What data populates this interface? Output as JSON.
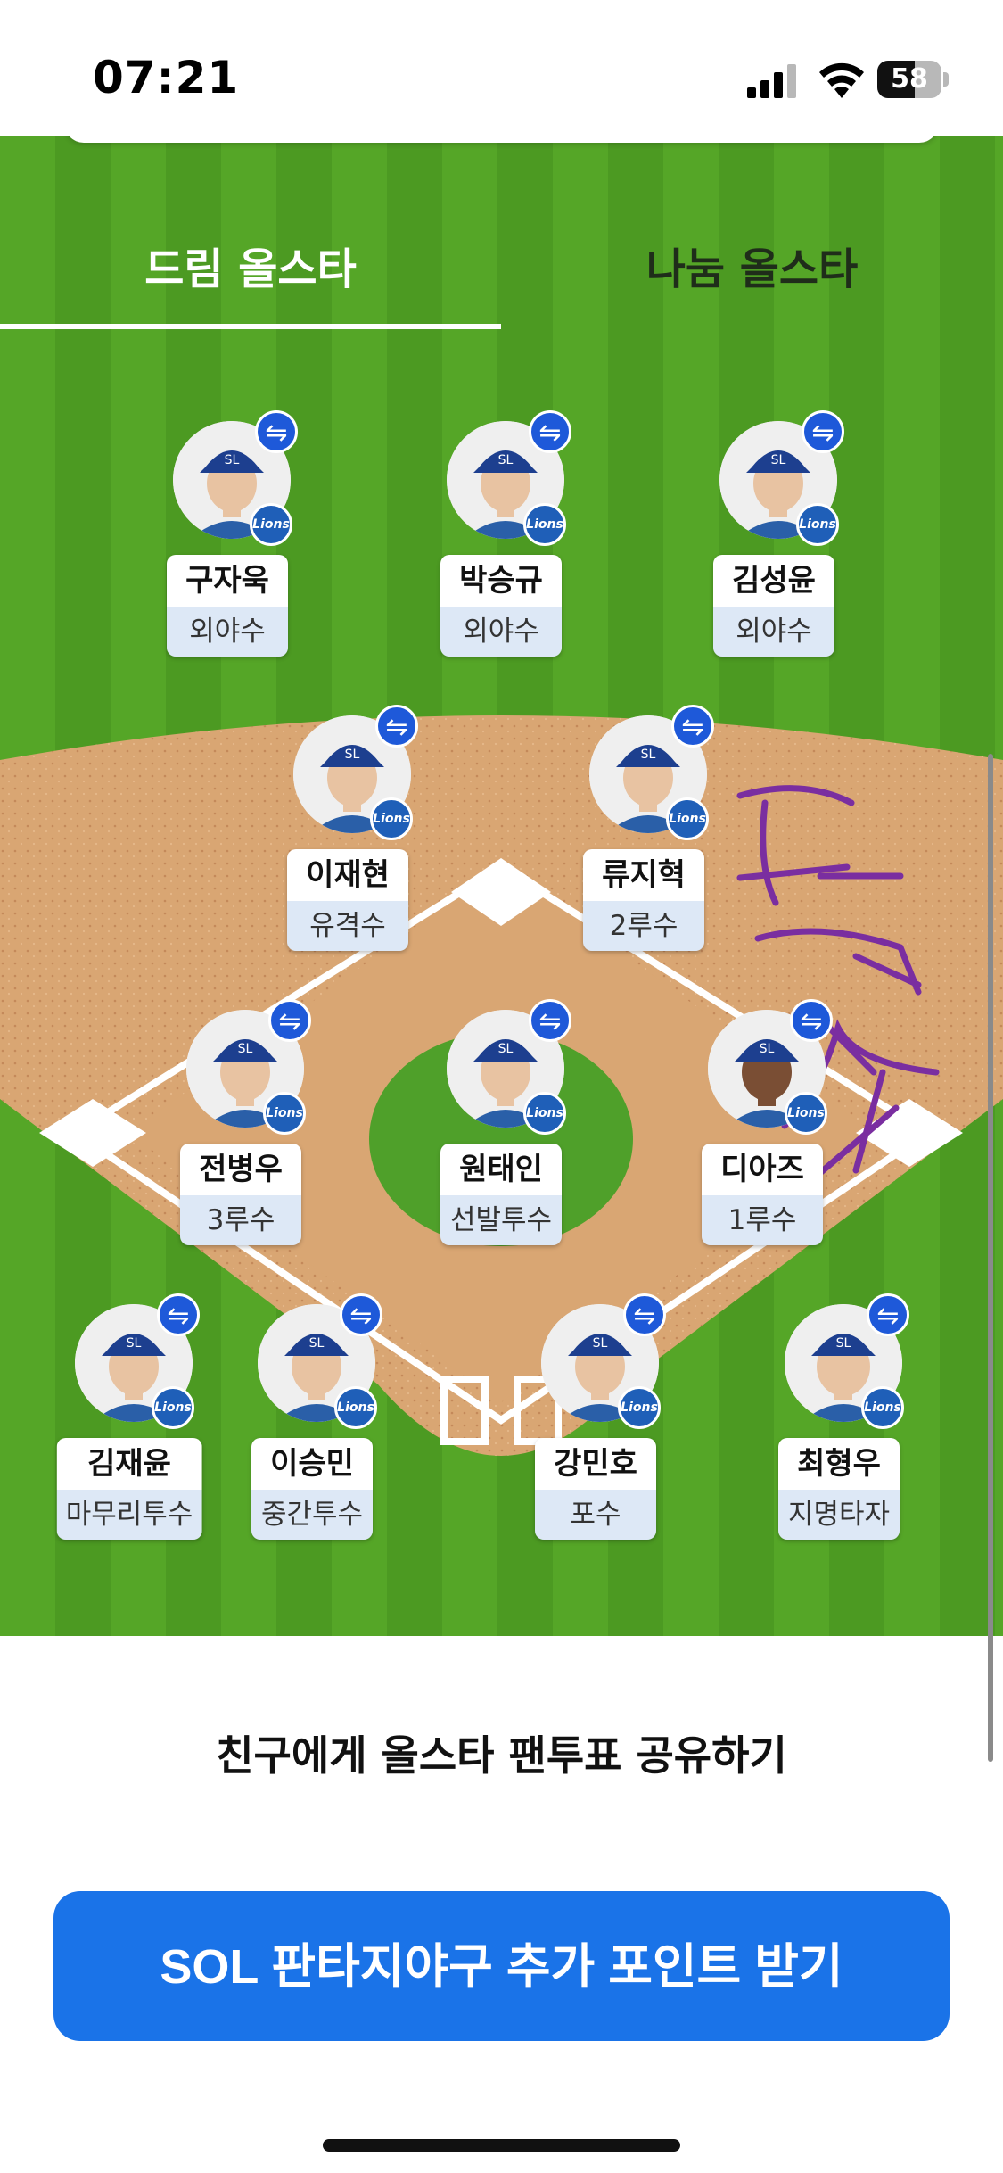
{
  "status_bar": {
    "time": "07:21",
    "battery": "58",
    "battery_level_percent": 58
  },
  "tabs": [
    {
      "label": "드림 올스타",
      "selected": true
    },
    {
      "label": "나눔 올스타",
      "selected": false
    }
  ],
  "colors": {
    "grass_light": "#55a627",
    "grass_dark": "#4c9a22",
    "dirt": "#d9a673",
    "swap_badge": "#1e59d9",
    "team_badge": "#1f5fb8",
    "position_bg": "#dde8f6",
    "cta_bg": "#1a73e8",
    "handwriting": "#7a2ea0"
  },
  "team_badge_text": "Lions",
  "swap_icon": "⇋",
  "players": [
    {
      "name": "구자욱",
      "position": "외야수"
    },
    {
      "name": "박승규",
      "position": "외야수"
    },
    {
      "name": "김성윤",
      "position": "외야수"
    },
    {
      "name": "이재현",
      "position": "유격수"
    },
    {
      "name": "류지혁",
      "position": "2루수"
    },
    {
      "name": "전병우",
      "position": "3루수"
    },
    {
      "name": "원태인",
      "position": "선발투수"
    },
    {
      "name": "디아즈",
      "position": "1루수"
    },
    {
      "name": "김재윤",
      "position": "마무리투수"
    },
    {
      "name": "이승민",
      "position": "중간투수"
    },
    {
      "name": "강민호",
      "position": "포수"
    },
    {
      "name": "최형우",
      "position": "지명타자"
    }
  ],
  "share_label": "친구에게 올스타 팬투표 공유하기",
  "cta_label": "SOL 판타지야구 추가 포인트 받기"
}
